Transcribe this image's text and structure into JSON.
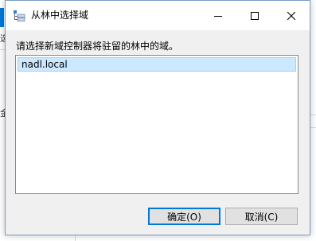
{
  "background": {
    "left_chars": [
      "选",
      "金"
    ]
  },
  "dialog": {
    "title": "从林中选择域",
    "controls": {
      "minimize": "minimize-icon",
      "maximize": "maximize-icon",
      "close": "close-icon"
    },
    "instruction": "请选择新域控制器将驻留的林中的域。",
    "domains": [
      "nadl.local"
    ],
    "selected_domain": "nadl.local",
    "buttons": {
      "ok": "确定(O)",
      "cancel": "取消(C)"
    }
  },
  "colors": {
    "selection_bg": "#cce8ff",
    "selection_border": "#99d1ff",
    "accent": "#0078d7",
    "dialog_bg": "#f0f0f0"
  }
}
